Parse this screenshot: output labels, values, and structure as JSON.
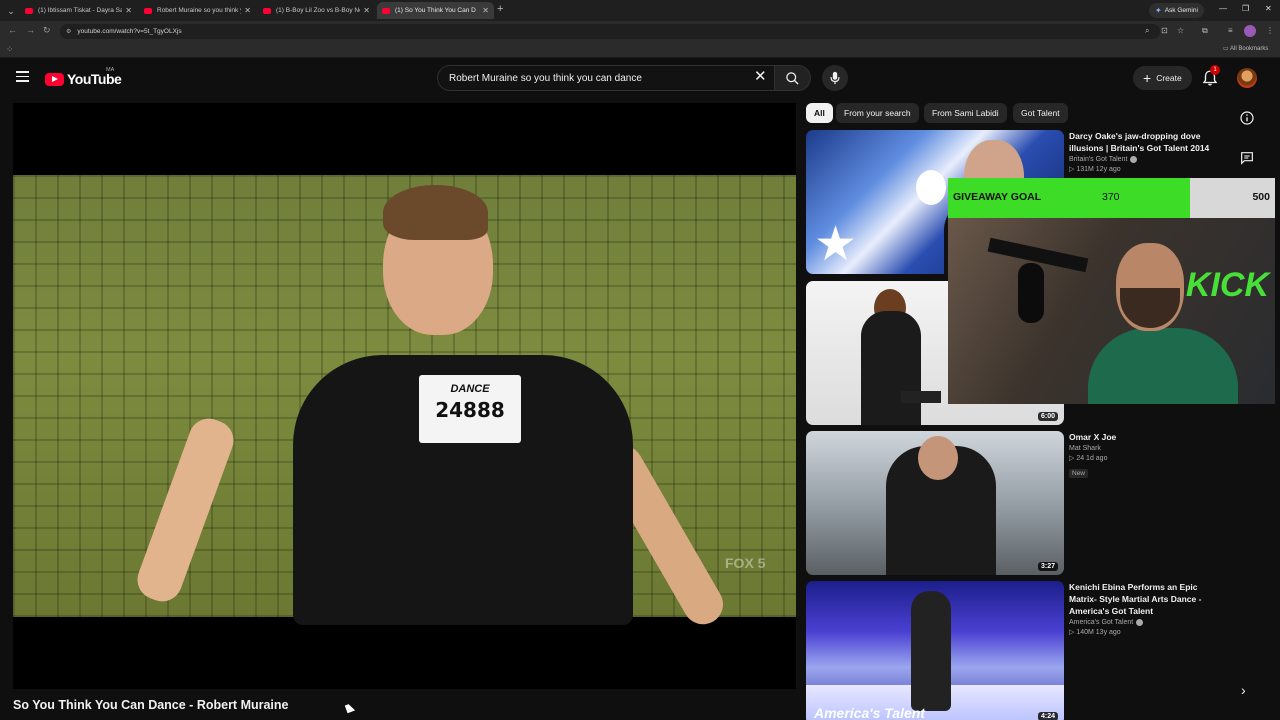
{
  "browser": {
    "tabs": [
      {
        "label": "(1) Ibtissam Tiskat - Dayra Sans",
        "active": false
      },
      {
        "label": "Robert Muraine so you think yo",
        "active": false
      },
      {
        "label": "(1) B-Boy Lil Zoo vs B-Boy Nega",
        "active": false
      },
      {
        "label": "(1) So You Think You Can D",
        "active": true
      }
    ],
    "gemini_label": "Ask Gemini",
    "url": "youtube.com/watch?v=5t_TgyOLXjs",
    "all_bookmarks": "All Bookmarks"
  },
  "youtube": {
    "logo_text": "YouTube",
    "region": "MA",
    "search_value": "Robert Muraine so you think you can dance",
    "create_label": "Create",
    "notification_count": "1"
  },
  "player": {
    "bib_top": "DANCE",
    "bib_number": "24888",
    "watermark": "FOX 5"
  },
  "video_title": "So You Think You Can Dance - Robert Muraine",
  "chips": [
    "All",
    "From your search",
    "From Sami Labidi",
    "Got Talent"
  ],
  "recommendations": [
    {
      "title": "Darcy Oake's jaw-dropping dove illusions | Britain's Got Talent 2014",
      "channel": "Britain's Got Talent",
      "stats": "▷ 131M   12y ago",
      "duration": ""
    },
    {
      "title": "",
      "channel": "",
      "stats": "",
      "duration": "6:00"
    },
    {
      "title": "Omar X Joe",
      "channel": "Mat Shark",
      "stats": "▷ 24   1d ago",
      "badge": "New",
      "duration": "3:27"
    },
    {
      "title": "Kenichi Ebina Performs an Epic Matrix- Style Martial Arts Dance - America's Got Talent",
      "channel": "America's Got Talent",
      "stats": "▷ 140M   13y ago",
      "duration": "4:24",
      "thumb_logo": "America's Talent"
    }
  ],
  "overlay": {
    "goal_label": "GIVEAWAY GOAL",
    "current": "370",
    "target": "500",
    "progress": 0.74,
    "cam_sign": "KICK"
  },
  "colors": {
    "background": "#0f0f0f",
    "youtube_red": "#ff0033",
    "goal_green": "#3ddc26"
  }
}
